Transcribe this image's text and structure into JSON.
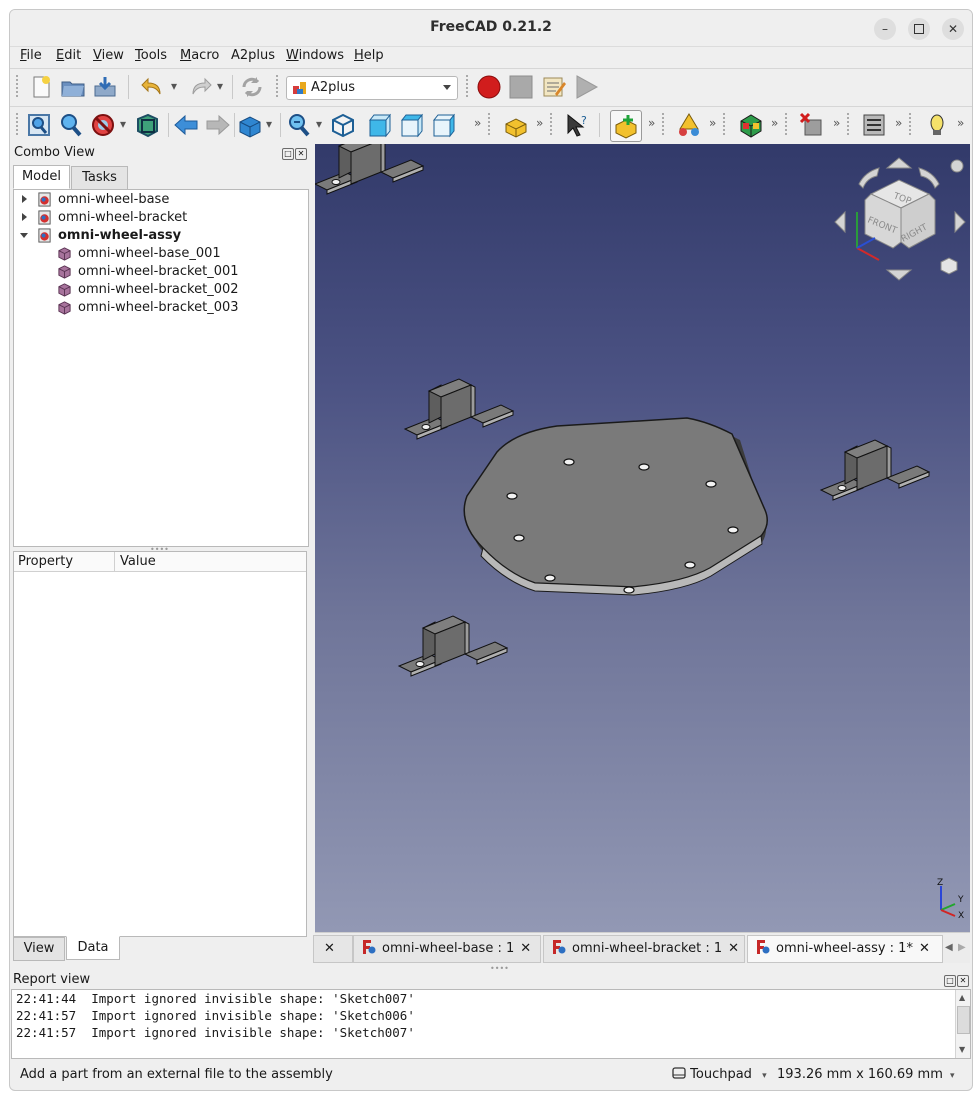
{
  "window": {
    "title": "FreeCAD 0.21.2"
  },
  "menu": [
    "File",
    "Edit",
    "View",
    "Tools",
    "Macro",
    "A2plus",
    "Windows",
    "Help"
  ],
  "menu_accel": [
    "F",
    "E",
    "V",
    "T",
    "M",
    "",
    "W",
    "H"
  ],
  "workbench": {
    "selected": "A2plus"
  },
  "combo_view": {
    "title": "Combo View",
    "tabs": [
      "Model",
      "Tasks"
    ],
    "tree": [
      {
        "label": "omni-wheel-base",
        "bold": false
      },
      {
        "label": "omni-wheel-bracket",
        "bold": false
      },
      {
        "label": "omni-wheel-assy",
        "bold": true
      },
      {
        "label": "omni-wheel-base_001",
        "bold": false
      },
      {
        "label": "omni-wheel-bracket_001",
        "bold": false
      },
      {
        "label": "omni-wheel-bracket_002",
        "bold": false
      },
      {
        "label": "omni-wheel-bracket_003",
        "bold": false
      }
    ],
    "property_headers": [
      "Property",
      "Value"
    ],
    "bottom_tabs": [
      "View",
      "Data"
    ]
  },
  "navcube": {
    "faces": [
      "TOP",
      "FRONT",
      "RIGHT"
    ]
  },
  "axis_labels": [
    "Z",
    "Y",
    "X"
  ],
  "doc_tabs": [
    {
      "label": "omni-wheel-base : 1",
      "active": false
    },
    {
      "label": "omni-wheel-bracket : 1",
      "active": false
    },
    {
      "label": "omni-wheel-assy : 1*",
      "active": true
    }
  ],
  "report_view": {
    "title": "Report view",
    "lines": [
      "22:41:44  Import ignored invisible shape: 'Sketch007'",
      "22:41:57  Import ignored invisible shape: 'Sketch006'",
      "22:41:57  Import ignored invisible shape: 'Sketch007'"
    ]
  },
  "status": {
    "message": "Add a part from an external file to the assembly",
    "nav_style": "Touchpad",
    "dimensions": "193.26 mm x 160.69 mm"
  },
  "colors": {
    "record": "#cc1b1b",
    "accent_blue": "#1e6fc7",
    "part_gray": "#7d7d7d"
  }
}
